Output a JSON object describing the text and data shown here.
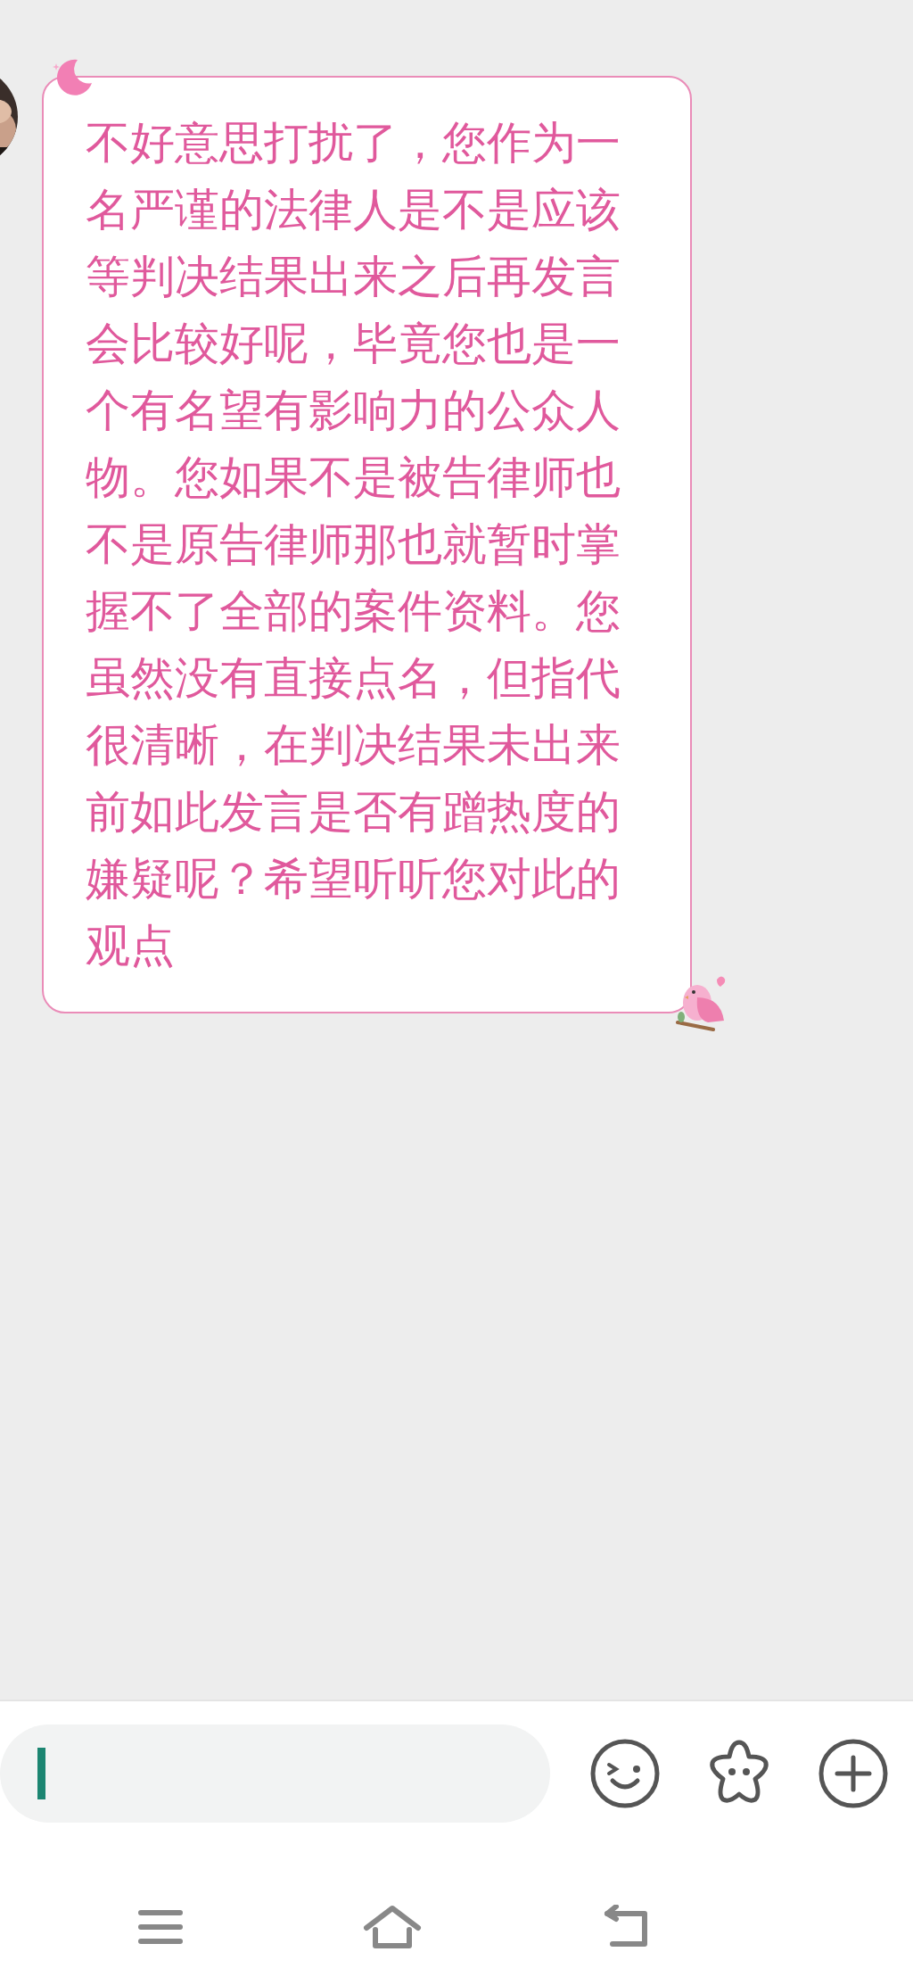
{
  "messages": [
    {
      "text": "不好意思打扰了，您作为一名严谨的法律人是不是应该等判决结果出来之后再发言会比较好呢，毕竟您也是一个有名望有影响力的公众人物。您如果不是被告律师也不是原告律师那也就暂时掌握不了全部的案件资料。您虽然没有直接点名，但指代很清晰，在判决结果未出来前如此发言是否有蹭热度的嫌疑呢？希望听听您对此的观点"
    }
  ]
}
